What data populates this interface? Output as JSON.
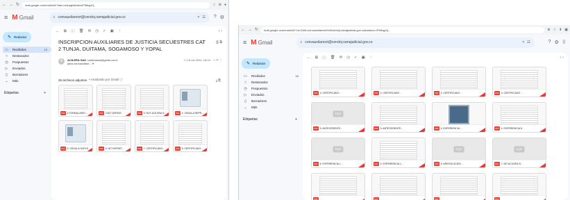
{
  "left": {
    "browser": {
      "url": "mail.google.com/mail/u/0/?tab=rm&ogbl#inbox/FMfcgzQ...",
      "toolbar_icons": [
        "star-icon",
        "extension-icon",
        "profile-icon"
      ]
    },
    "app": {
      "name": "Gmail"
    },
    "search": {
      "value": "convauxilaresrt@cendoj.ramajudicial.gov.co",
      "clear": "×",
      "filter": "☷"
    },
    "header_icons": [
      "?",
      "⚙"
    ],
    "compose_label": "Redactar",
    "nav": [
      {
        "icon": "▭",
        "label": "Recibidos",
        "count": "10"
      },
      {
        "icon": "☆",
        "label": "Destacados",
        "count": ""
      },
      {
        "icon": "◷",
        "label": "Pospuestos",
        "count": ""
      },
      {
        "icon": "▷",
        "label": "Enviados",
        "count": ""
      },
      {
        "icon": "▯",
        "label": "Borradores",
        "count": ""
      },
      {
        "icon": "⌄",
        "label": "Más",
        "count": ""
      }
    ],
    "labels": {
      "title": "Etiquetas",
      "add": "+"
    },
    "mail_toolbar": [
      "←",
      "⊠",
      "ⓘ",
      "🗑",
      "✉",
      "◷",
      "✓",
      "▣",
      "⋮"
    ],
    "pager": "‹ ›",
    "subject": "INSCRIPCION AUXILIARES DE JUSTICIA SECUESTRES CAT 2 TUNJA, DUITAMA, SOGAMOSO Y YOPAL",
    "subject_icons": "⎙ ⧉",
    "sender": {
      "name": "ACILERA SAS",
      "email": "<acilerasas@gmail.com>",
      "to": "para convauxilare... ▾",
      "date": "☐ 15 oct 2024, 18:04",
      "actions": "☆ ↶ ⋮"
    },
    "attachments": {
      "count_label": "26 archivos adjuntos",
      "scanned": "• Analizado por Gmail ⓘ",
      "actions": "⤓  ⎘",
      "items": [
        {
          "name": "1.FORMULARIO...",
          "thumb": "doc"
        },
        {
          "name": "2.NIT DEFINIT...",
          "thumb": "doc"
        },
        {
          "name": "3. RUT ACILERA S...",
          "thumb": "doc"
        },
        {
          "name": "4. CEDULA REPR...",
          "thumb": "card"
        },
        {
          "name": "5. CEDULA SUPLE...",
          "thumb": "card"
        },
        {
          "name": "6. NIT DEFINIT...",
          "thumb": "doc"
        },
        {
          "name": "7. CERTIFICADO...",
          "thumb": "doc"
        },
        {
          "name": "8. CERTIFICADO...",
          "thumb": "doc"
        }
      ]
    }
  },
  "right": {
    "browser": {
      "url": "mail.google.com/mail/u/0/?ui=2&ik=convauxilaresrt%40cendoj.ramajudicial.gov.co&search=/FMfcgzQ...",
      "toolbar_icons": [
        "⊕",
        "☆",
        "⬇",
        "▣"
      ]
    },
    "app": {
      "name": "Gmail"
    },
    "search": {
      "value": "convauxilaresrt@cendoj.ramajudicial.gov.co",
      "clear": "×",
      "filter": "☷"
    },
    "header_icons": [
      "?",
      "⚙",
      "⠿"
    ],
    "compose_label": "Redactar",
    "nav": [
      {
        "icon": "▭",
        "label": "Recibidos",
        "count": "40"
      },
      {
        "icon": "☆",
        "label": "Destacados",
        "count": ""
      },
      {
        "icon": "◷",
        "label": "Pospuestos",
        "count": ""
      },
      {
        "icon": "▷",
        "label": "Enviados",
        "count": ""
      },
      {
        "icon": "▯",
        "label": "Borradores",
        "count": ""
      },
      {
        "icon": "⌄",
        "label": "Más",
        "count": ""
      }
    ],
    "labels": {
      "title": "Etiquetas",
      "add": "+"
    },
    "mail_toolbar": [
      "←",
      "⊠",
      "ⓘ",
      "🗑",
      "✉",
      "◷",
      "✓",
      "▣",
      "⋮"
    ],
    "pager": "‹ ›",
    "attachments": [
      {
        "name": "3. CERTIFICADO ...",
        "thumb": "doc"
      },
      {
        "name": "4. CERTIFICADO ...",
        "thumb": "doc"
      },
      {
        "name": "4. CERTIFICADO ...",
        "thumb": "doc"
      },
      {
        "name": "4. CERTIFICADO ...",
        "thumb": "doc"
      },
      {
        "name": "5. ANTECEDENTE...",
        "thumb": "pdf"
      },
      {
        "name": "5. ANTECEDENTE...",
        "thumb": "doc"
      },
      {
        "name": "6. EXPERIENCIA ...",
        "thumb": "photo"
      },
      {
        "name": "6. EXPERIENCIA 5...",
        "thumb": "doc"
      },
      {
        "name": "6. EXPERIENCIA L...",
        "thumb": "pdf"
      },
      {
        "name": "6. EXPERIENCIA L...",
        "thumb": "doc"
      },
      {
        "name": "5. ARESOLUCION ...",
        "thumb": "pdf"
      },
      {
        "name": "7. NIT ACILERA S...",
        "thumb": "pdf"
      },
      {
        "name": "",
        "thumb": "doc"
      },
      {
        "name": "",
        "thumb": "doc"
      },
      {
        "name": "",
        "thumb": "doc"
      },
      {
        "name": "",
        "thumb": "doc"
      }
    ]
  }
}
